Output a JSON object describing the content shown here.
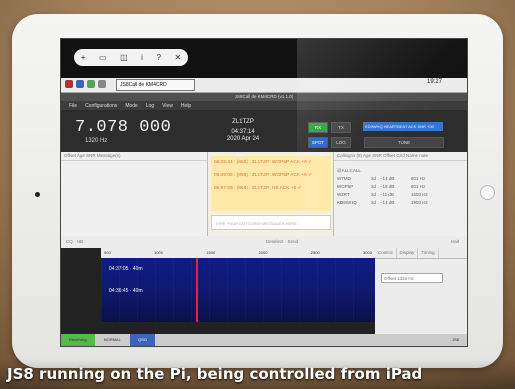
{
  "photo": {
    "caption": "JS8 running on the Pi, being controlled from iPad"
  },
  "ios_toolbar": {
    "items": [
      "+",
      "▭",
      "◫",
      "i",
      "?",
      "✕"
    ]
  },
  "desktop": {
    "app_title": "JS8Call de KM4CRD",
    "clock": "19:27"
  },
  "window": {
    "title": "JS8Call de KM4CRD (v1.1.0)"
  },
  "menu": {
    "items": [
      "File",
      "Configurations",
      "Mode",
      "Log",
      "View",
      "Help"
    ]
  },
  "app": {
    "frequency": "7.078 000",
    "offset": "1320 Hz",
    "callsign": "ZL1TZP",
    "time": "04:37:14",
    "date": "2020 Apr 24",
    "buttons": [
      "RX",
      "TX",
      "SPOT",
      "LOG",
      "TUNE"
    ],
    "ticker": "KD9WHQ HEARTBEAT ACK SNR +00"
  },
  "columns": {
    "left_header": "Offset  Age  SNR      Message(s)",
    "right_header": "Callsigns (9)  Age  SNR  Offset  Grid  Name  note"
  },
  "activity": {
    "lines": [
      "06:35:44 : (868) : ZL1TZP: WOP6P ACK +6 ✓",
      "06:49:09 : (868) : ZL1TZP: WOP6P ACK +6 ✓",
      "06:57:09 : (868) : ZL1TZP: HB ACK +6 ✓"
    ],
    "input_placeholder": "TYPE YOUR OUTGOING MESSAGES HERE."
  },
  "callsigns": [
    {
      "name": "@ALLCALL",
      "age": "",
      "snr": "",
      "offset": ""
    },
    {
      "name": "W7MD",
      "age": "2d",
      "snr": "-14 dB",
      "offset": "801 Hz"
    },
    {
      "name": "WOP6P",
      "age": "2d",
      "snr": "-16 dB",
      "offset": "801 Hz"
    },
    {
      "name": "W2RT",
      "age": "2d",
      "snr": "-11 dB",
      "offset": "1650 Hz"
    },
    {
      "name": "KD9WHQ",
      "age": "2d",
      "snr": "-14 dB",
      "offset": "1950 Hz"
    }
  ],
  "controls": {
    "left": "CQ  ·  HB",
    "middle": "Deselect  ·  Send",
    "right": "Halt"
  },
  "waterfall": {
    "scale": [
      "500",
      "1000",
      "1500",
      "2000",
      "2500",
      "3000"
    ],
    "labels": [
      "04:37:05 · 40m",
      "04:36:45 · 40m"
    ],
    "tabs": [
      "Control",
      "Display",
      "Timing"
    ],
    "offset": "Offset  1320 Hz"
  },
  "status": {
    "mode": "Receiving",
    "speed": "NORMAL",
    "qso": "QSO",
    "right": "JS8"
  }
}
